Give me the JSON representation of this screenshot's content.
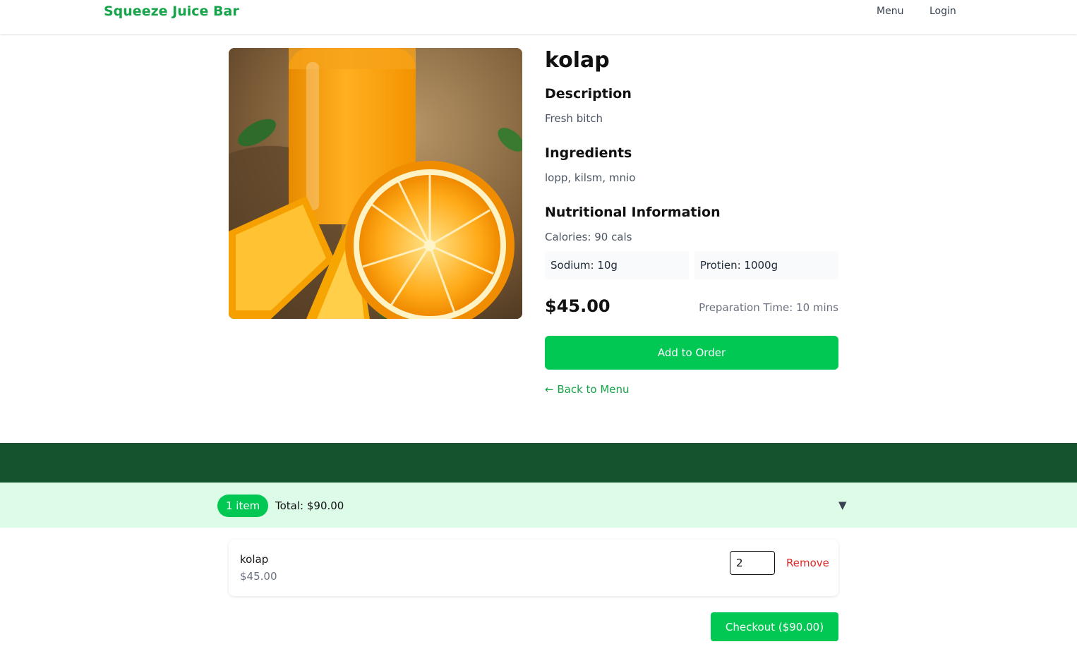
{
  "header": {
    "brand": "Squeeze Juice Bar",
    "nav": {
      "menu": "Menu",
      "login": "Login"
    }
  },
  "product": {
    "name": "kolap",
    "description_heading": "Description",
    "description": "Fresh bitch",
    "ingredients_heading": "Ingredients",
    "ingredients": "lopp, kilsm, mnio",
    "nutrition_heading": "Nutritional Information",
    "calories": "Calories: 90 cals",
    "sodium": "Sodium: 10g",
    "protein": "Protien: 1000g",
    "price": "$45.00",
    "prep_time": "Preparation Time: 10 mins",
    "add_button": "Add to Order",
    "back_link": "← Back to Menu"
  },
  "cart": {
    "count_badge": "1 item",
    "total": "Total: $90.00",
    "toggle": "▼",
    "items": [
      {
        "name": "kolap",
        "price": "$45.00",
        "quantity": "2",
        "remove_label": "Remove"
      }
    ],
    "checkout_button": "Checkout ($90.00)"
  },
  "colors": {
    "accent": "#00c853",
    "brand": "#16a34a",
    "footer": "#14532d",
    "cart_bar": "#dcfce7",
    "danger": "#dc2626"
  }
}
